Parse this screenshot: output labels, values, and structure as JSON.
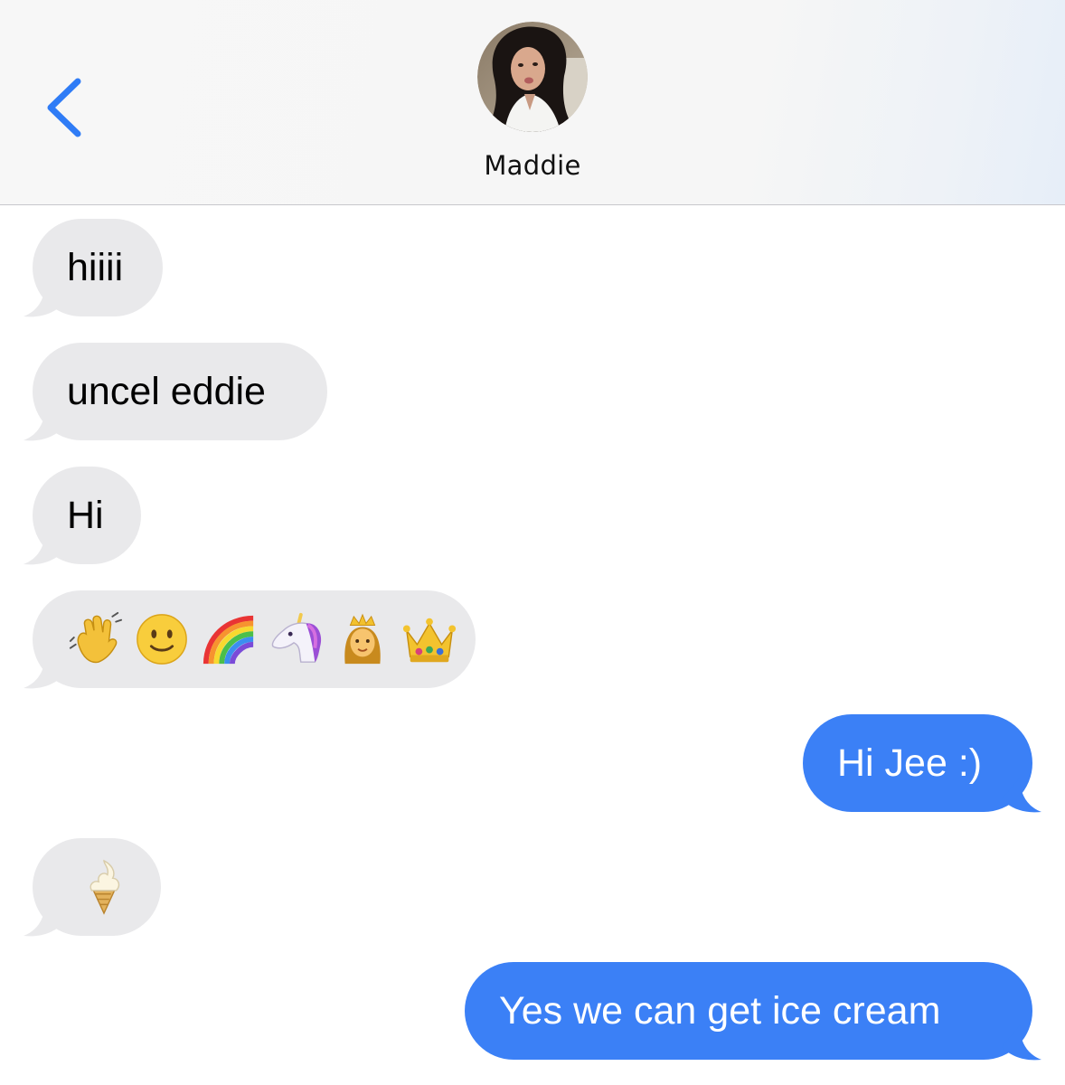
{
  "header": {
    "contact_name": "Maddie",
    "back_icon": "chevron-left-icon",
    "accent_color": "#2f7cf6"
  },
  "messages": [
    {
      "direction": "incoming",
      "text": "hiiii"
    },
    {
      "direction": "incoming",
      "text": "uncel eddie"
    },
    {
      "direction": "incoming",
      "text": "Hi"
    },
    {
      "direction": "incoming",
      "emojis": [
        "waving-hand-emoji",
        "slightly-smiling-face-emoji",
        "rainbow-emoji",
        "unicorn-emoji",
        "princess-emoji",
        "crown-emoji"
      ]
    },
    {
      "direction": "outgoing",
      "text": "Hi Jee :)"
    },
    {
      "direction": "incoming",
      "emojis": [
        "soft-ice-cream-emoji"
      ]
    },
    {
      "direction": "outgoing",
      "text": "Yes we can get ice cream"
    }
  ],
  "colors": {
    "incoming_bubble": "#e9e9eb",
    "outgoing_bubble": "#3b80f6"
  }
}
